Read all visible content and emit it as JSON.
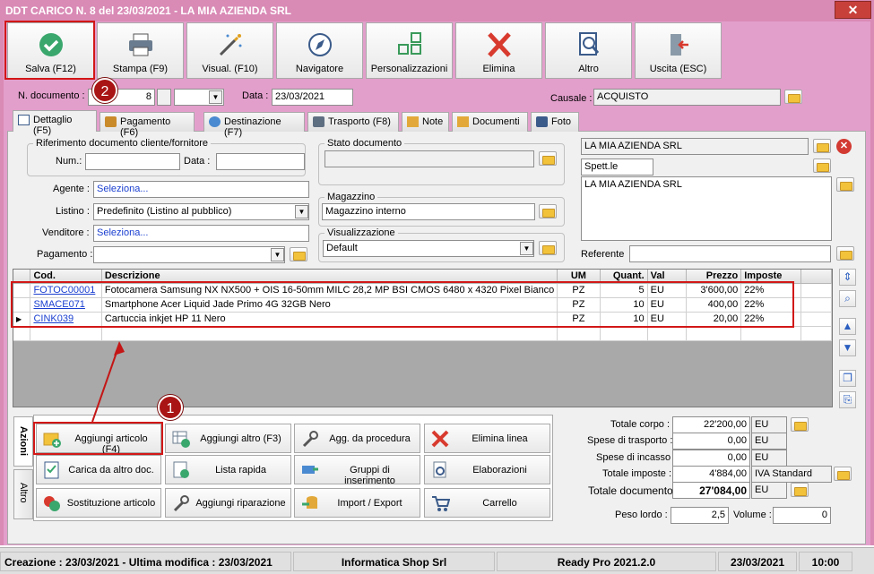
{
  "window": {
    "title": "DDT CARICO N. 8 del 23/03/2021 - LA MIA AZIENDA SRL",
    "close_label": "✕"
  },
  "toolbar": [
    {
      "label": "Salva (F12)",
      "icon": "checkmark-icon"
    },
    {
      "label": "Stampa (F9)",
      "icon": "printer-icon"
    },
    {
      "label": "Visual. (F10)",
      "icon": "magic-wand-icon"
    },
    {
      "label": "Navigatore",
      "icon": "compass-icon"
    },
    {
      "label": "Personalizzazioni",
      "icon": "grid-blocks-icon"
    },
    {
      "label": "Elimina",
      "icon": "delete-x-icon"
    },
    {
      "label": "Altro",
      "icon": "magnifier-doc-icon"
    },
    {
      "label": "Uscita (ESC)",
      "icon": "exit-door-icon"
    }
  ],
  "header": {
    "doc_number_label": "N. documento :",
    "doc_number": "8",
    "date_label": "Data :",
    "date": "23/03/2021",
    "causale_label": "Causale :",
    "causale": "ACQUISTO"
  },
  "tabs": [
    "Dettaglio (F5)",
    "Pagamento (F6)",
    "Destinazione (F7)",
    "Trasporto (F8)",
    "Note",
    "Documenti",
    "Foto"
  ],
  "riferimento": {
    "title": "Riferimento documento cliente/fornitore",
    "num_label": "Num.:",
    "data_label": "Data :"
  },
  "fields": {
    "agente_label": "Agente :",
    "agente": "Seleziona...",
    "listino_label": "Listino :",
    "listino": "Predefinito (Listino al pubblico)",
    "venditore_label": "Venditore :",
    "venditore": "Seleziona...",
    "pagamento_label": "Pagamento :"
  },
  "stato": {
    "title": "Stato documento"
  },
  "magazzino": {
    "title": "Magazzino",
    "value": "Magazzino interno"
  },
  "visualizzazione": {
    "title": "Visualizzazione",
    "value": "Default"
  },
  "cliente": {
    "name": "LA MIA AZIENDA SRL",
    "salutation": "Spett.le",
    "address": "LA MIA AZIENDA SRL",
    "referente_label": "Referente"
  },
  "grid": {
    "columns": [
      "Cod.",
      "Descrizione",
      "UM",
      "Quant.",
      "Val",
      "Prezzo",
      "Imposte"
    ],
    "rows": [
      {
        "cod": "FOTOC00001",
        "desc": "Fotocamera Samsung NX NX500 + OIS 16-50mm MILC 28,2 MP BSI CMOS 6480 x 4320 Pixel Bianco",
        "um": "PZ",
        "qty": "5",
        "val": "EU",
        "prezzo": "3'600,00",
        "imposte": "22%"
      },
      {
        "cod": "SMACE071",
        "desc": "Smartphone Acer Liquid Jade Primo 4G 32GB Nero",
        "um": "PZ",
        "qty": "10",
        "val": "EU",
        "prezzo": "400,00",
        "imposte": "22%"
      },
      {
        "cod": "CINK039",
        "desc": "Cartuccia inkjet HP 11 Nero",
        "um": "PZ",
        "qty": "10",
        "val": "EU",
        "prezzo": "20,00",
        "imposte": "22%"
      }
    ]
  },
  "azioni": {
    "tab_label": "Azioni",
    "tab2_label": "Altro",
    "buttons": [
      {
        "label": "Aggiungi articolo (F4)"
      },
      {
        "label": "Aggiungi altro (F3)"
      },
      {
        "label": "Agg. da procedura"
      },
      {
        "label": "Elimina linea"
      },
      {
        "label": "Carica da altro doc."
      },
      {
        "label": "Lista rapida"
      },
      {
        "label": "Gruppi di inserimento"
      },
      {
        "label": "Elaborazioni"
      },
      {
        "label": "Sostituzione articolo"
      },
      {
        "label": "Aggiungi riparazione"
      },
      {
        "label": "Import / Export"
      },
      {
        "label": "Carrello"
      }
    ]
  },
  "totals": {
    "corpo_label": "Totale corpo :",
    "corpo": "22'200,00",
    "corpo_cur": "EU",
    "trasporto_label": "Spese di trasporto :",
    "trasporto": "0,00",
    "trasporto_cur": "EU",
    "incasso_label": "Spese di incasso :",
    "incasso": "0,00",
    "incasso_cur": "EU",
    "imposte_label": "Totale imposte :",
    "imposte": "4'884,00",
    "imposte_desc": "IVA Standard",
    "documento_label": "Totale documento :",
    "documento": "27'084,00",
    "documento_cur": "EU",
    "peso_label": "Peso lordo :",
    "peso": "2,5",
    "volume_label": "Volume :",
    "volume": "0"
  },
  "status": {
    "dates": "Creazione : 23/03/2021 - Ultima modifica : 23/03/2021",
    "company": "Informatica Shop Srl",
    "version": "Ready Pro 2021.2.0",
    "date": "23/03/2021",
    "time": "10:00"
  },
  "annotations": {
    "badge1": "1",
    "badge2": "2"
  },
  "colors": {
    "title_bg": "#d98ab5",
    "frame_bg": "#e39fcc",
    "highlight": "#d21717"
  }
}
